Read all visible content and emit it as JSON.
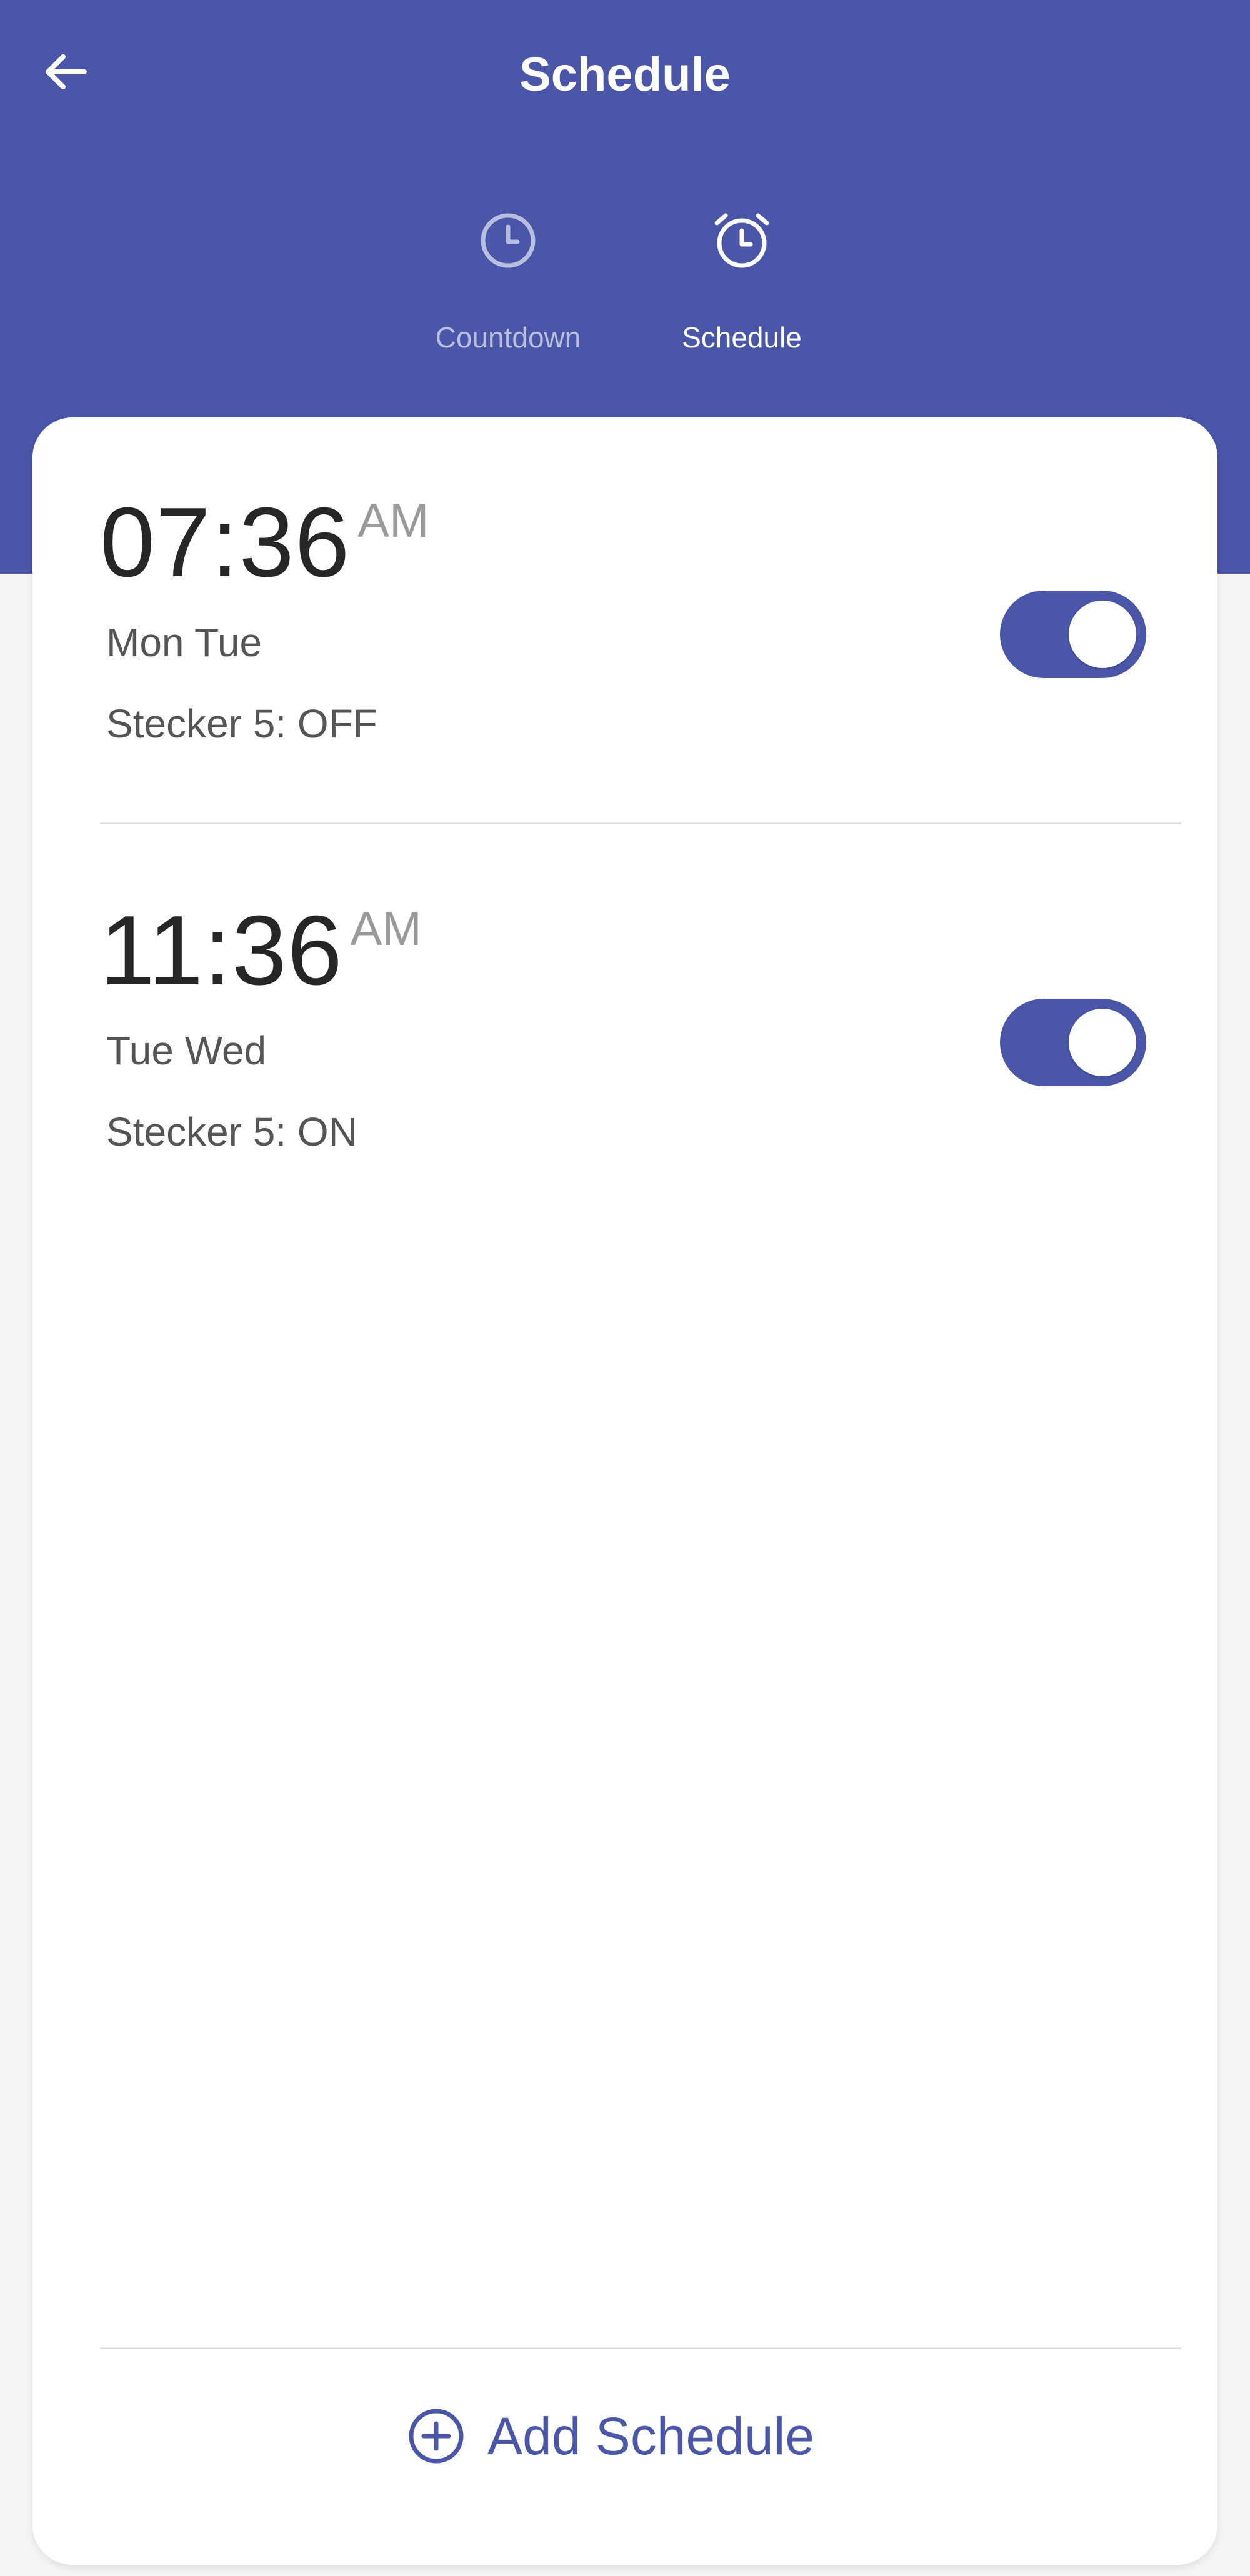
{
  "header": {
    "title": "Schedule",
    "back_icon": "arrow-left-icon"
  },
  "tabs": [
    {
      "label": "Countdown",
      "icon": "clock-icon",
      "active": false
    },
    {
      "label": "Schedule",
      "icon": "alarm-clock-icon",
      "active": true
    }
  ],
  "schedules": [
    {
      "time": "07:36",
      "ampm": "AM",
      "days": "Mon Tue",
      "action": "Stecker 5: OFF",
      "enabled": true
    },
    {
      "time": "11:36",
      "ampm": "AM",
      "days": "Tue Wed",
      "action": "Stecker 5: ON",
      "enabled": true
    }
  ],
  "footer": {
    "add_label": "Add Schedule",
    "add_icon": "plus-circle-icon"
  },
  "colors": {
    "primary": "#4a56a8",
    "background": "#f5f5f5",
    "card": "#ffffff",
    "text_dark": "#262626",
    "text_muted": "#555555",
    "ampm": "#9a9a9a",
    "tab_inactive": "#b9bee0"
  }
}
